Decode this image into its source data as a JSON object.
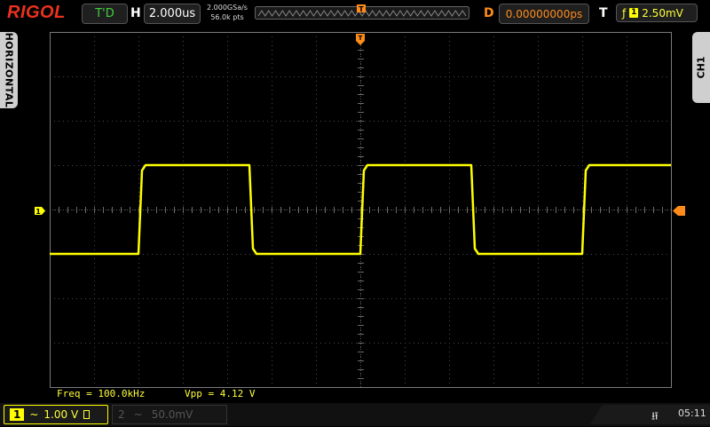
{
  "top_bar": {
    "brand": "RIGOL",
    "run_state": "T'D",
    "horizontal_letter": "H",
    "timebase": "2.000us",
    "sample_rate": "2.000GSa/s",
    "memory_depth": "56.0k pts",
    "delay_letter": "D",
    "delay": "0.00000000ps",
    "trigger_letter": "T",
    "trigger_source": "1",
    "trigger_level": "2.50mV"
  },
  "side_tabs": {
    "left": "HORIZONTAL",
    "right": "CH1"
  },
  "markers": {
    "channel1": "1",
    "trigger_pos": "T"
  },
  "measurements": {
    "freq": "Freq = 100.0kHz",
    "vpp": "Vpp = 4.12 V"
  },
  "bottom_bar": {
    "ch1": {
      "number": "1",
      "coupling": "~",
      "scale": "1.00 V"
    },
    "ch2": {
      "number": "2",
      "coupling": "~",
      "scale": "50.0mV"
    },
    "time": "05:11"
  },
  "colors": {
    "ch1": "#ffff00",
    "trigger": "#ff8c1a",
    "brand": "#e8321e",
    "run_state": "#41d13d"
  },
  "waveform": {
    "type": "square",
    "frequency_khz": 100,
    "timebase_us_per_div": 2,
    "volts_per_div": 1,
    "high_level_div": 1.0,
    "low_level_div": -1.0,
    "first_rising_edge_div": 2
  }
}
